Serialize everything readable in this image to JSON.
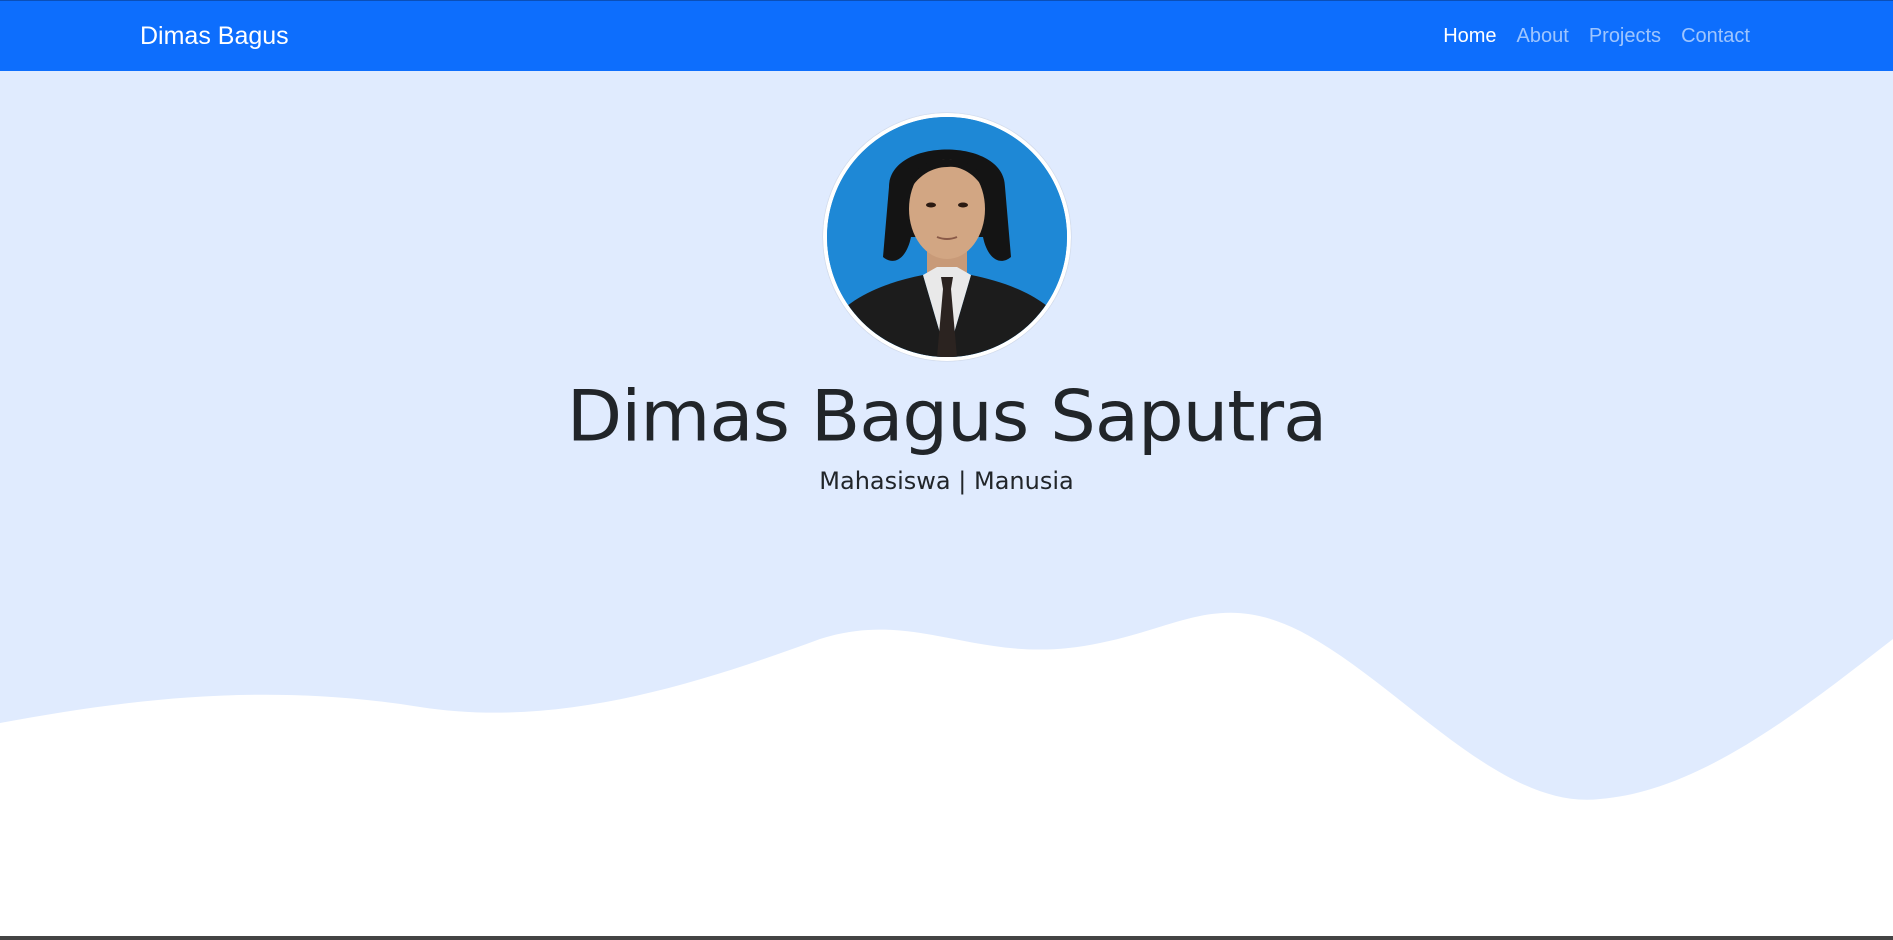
{
  "navbar": {
    "brand": "Dimas Bagus",
    "links": [
      {
        "label": "Home",
        "active": true
      },
      {
        "label": "About",
        "active": false
      },
      {
        "label": "Projects",
        "active": false
      },
      {
        "label": "Contact",
        "active": false
      }
    ]
  },
  "hero": {
    "avatar_alt": "profile photo",
    "name": "Dimas Bagus Saputra",
    "tagline": "Mahasiswa | Manusia"
  },
  "colors": {
    "navbar_bg": "#0d6efd",
    "hero_bg": "#e0ebfe",
    "wave_fill": "#ffffff",
    "text": "#212529"
  }
}
